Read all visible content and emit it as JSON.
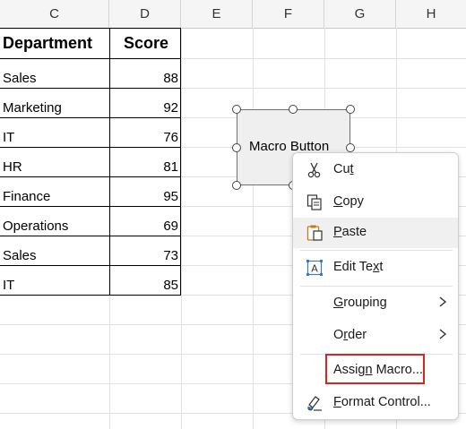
{
  "columns": [
    "C",
    "D",
    "E",
    "F",
    "G",
    "H"
  ],
  "table": {
    "headers": [
      "Department",
      "Score"
    ],
    "rows": [
      {
        "department": "Sales",
        "score": "88"
      },
      {
        "department": "Marketing",
        "score": "92"
      },
      {
        "department": "IT",
        "score": "76"
      },
      {
        "department": "HR",
        "score": "81"
      },
      {
        "department": "Finance",
        "score": "95"
      },
      {
        "department": "Operations",
        "score": "69"
      },
      {
        "department": "Sales",
        "score": "73"
      },
      {
        "department": "IT",
        "score": "85"
      }
    ]
  },
  "shape": {
    "label": "Macro Button"
  },
  "context_menu": {
    "items": [
      {
        "label_pre": "Cu",
        "accel": "t",
        "label_post": "",
        "icon": "scissors-icon"
      },
      {
        "label_pre": "",
        "accel": "C",
        "label_post": "opy",
        "icon": "copy-icon"
      },
      {
        "label_pre": "",
        "accel": "P",
        "label_post": "aste",
        "icon": "paste-icon"
      },
      {
        "label_pre": "Edit Te",
        "accel": "x",
        "label_post": "t",
        "icon": "edit-text-icon"
      },
      {
        "label_pre": "",
        "accel": "G",
        "label_post": "rouping",
        "icon": ""
      },
      {
        "label_pre": "O",
        "accel": "r",
        "label_post": "der",
        "icon": ""
      },
      {
        "label_pre": "Assig",
        "accel": "n",
        "label_post": " Macro...",
        "icon": ""
      },
      {
        "label_pre": "",
        "accel": "F",
        "label_post": "ormat Control...",
        "icon": "format-control-icon"
      }
    ]
  },
  "colors": {
    "highlight": "#d9251c",
    "menu_hover": "#f0f0f0",
    "grid": "#e2e2e2"
  }
}
